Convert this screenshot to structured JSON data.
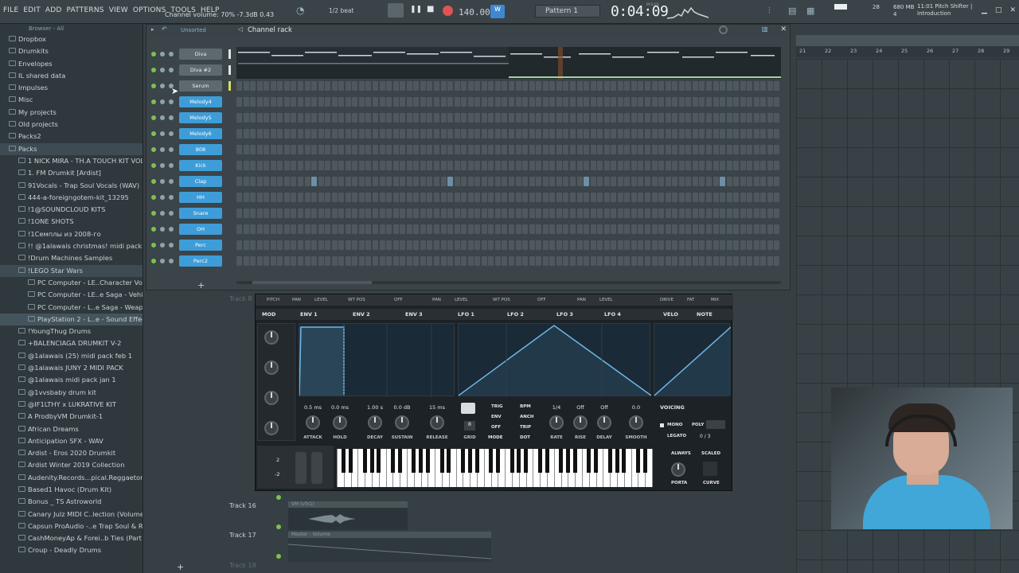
{
  "menu": [
    "FILE",
    "EDIT",
    "ADD",
    "PATTERNS",
    "VIEW",
    "OPTIONS",
    "TOOLS",
    "HELP"
  ],
  "hint_text": "Channel volume: 70%  -7.3dB  0.43",
  "beat_snap": "1/2 beat",
  "tempo": "140.000",
  "pattern": "Pattern 1",
  "song_time": "0:04:09",
  "time_unit": "M:S:CS",
  "cpu_value": "28",
  "mem": "680 MB",
  "voices": "4",
  "hint_right_time": "11:01",
  "hint_right_title": "Pitch Shifter |",
  "hint_right_sub": "Introduction",
  "browser": {
    "header": "Browser - All",
    "items": [
      {
        "label": "Dropbox",
        "indent": 0
      },
      {
        "label": "Drumkits",
        "indent": 0
      },
      {
        "label": "Envelopes",
        "indent": 0
      },
      {
        "label": "IL shared data",
        "indent": 0
      },
      {
        "label": "Impulses",
        "indent": 0
      },
      {
        "label": "Misc",
        "indent": 0
      },
      {
        "label": "My projects",
        "indent": 0
      },
      {
        "label": "Old projects",
        "indent": 0
      },
      {
        "label": "Packs2",
        "indent": 0
      },
      {
        "label": "Packs",
        "indent": 0,
        "sel": "sel2"
      },
      {
        "label": "1 NICK MIRA - TH.A TOUCH KIT VOL 1",
        "indent": 1
      },
      {
        "label": "1. FM Drumkit [Ardist]",
        "indent": 1
      },
      {
        "label": "91Vocals - Trap Soul Vocals (WAV)",
        "indent": 1
      },
      {
        "label": "444-a-foreigngotem-kit_13295",
        "indent": 1
      },
      {
        "label": "!1@SOUNDCLOUD KITS",
        "indent": 1
      },
      {
        "label": "!1ONE SHOTS",
        "indent": 1
      },
      {
        "label": "!1Семплы из 2008-го",
        "indent": 1
      },
      {
        "label": "!! @1alawais christmas! midi pack",
        "indent": 1
      },
      {
        "label": "!Drum Machines Samples",
        "indent": 1
      },
      {
        "label": "!LEGO Star Wars",
        "indent": 1,
        "sel": "sel2"
      },
      {
        "label": "PC Computer - LE..Character Voices",
        "indent": 2
      },
      {
        "label": "PC Computer - LE..e Saga - Vehicles",
        "indent": 2
      },
      {
        "label": "PC Computer - L..e Saga - Weapons",
        "indent": 2
      },
      {
        "label": "PlayStation 2 - L..e - Sound Effects",
        "indent": 2,
        "sel": "sel"
      },
      {
        "label": "!YoungThug Drums",
        "indent": 1
      },
      {
        "label": "+BALENCIAGA DRUMKIT V-2",
        "indent": 1
      },
      {
        "label": "@1alawais (25) midi pack feb 1",
        "indent": 1
      },
      {
        "label": "@1alawais JUNY 2 MIDI PACK",
        "indent": 1
      },
      {
        "label": "@1alawais midi pack jan 1",
        "indent": 1
      },
      {
        "label": "@1vvsbaby drum kit",
        "indent": 1
      },
      {
        "label": "@IF1LTHY x LUKRATIVE KIT",
        "indent": 1
      },
      {
        "label": "A ProdbyVM Drumkit-1",
        "indent": 1
      },
      {
        "label": "African Dreams",
        "indent": 1
      },
      {
        "label": "Anticipation SFX - WAV",
        "indent": 1
      },
      {
        "label": "Ardist - Eros 2020 Drumkit",
        "indent": 1
      },
      {
        "label": "Ardist Winter 2019 Collection",
        "indent": 1
      },
      {
        "label": "Audenity.Records...pical.Reggaeton.2",
        "indent": 1
      },
      {
        "label": "Based1 Havoc (Drum Kit)",
        "indent": 1
      },
      {
        "label": "Bonus _ TS Astroworld",
        "indent": 1
      },
      {
        "label": "Canary Julz MIDI C..lection (Volume 1)",
        "indent": 1
      },
      {
        "label": "Capsun ProAudio -..e Trap Soul & RnB",
        "indent": 1
      },
      {
        "label": "CashMoneyAp & Forei..b Ties (Part II )",
        "indent": 1
      },
      {
        "label": "Croup - Deadly Drums",
        "indent": 1
      }
    ]
  },
  "rack": {
    "filter": "Unsorted",
    "title": "Channel rack",
    "channels": [
      {
        "name": "Diva",
        "style": "gray"
      },
      {
        "name": "Diva #2",
        "style": "gray"
      },
      {
        "name": "Serum",
        "style": "gray"
      },
      {
        "name": "Melody4",
        "style": "blue"
      },
      {
        "name": "Melody5",
        "style": "blue"
      },
      {
        "name": "Melody6",
        "style": "blue"
      },
      {
        "name": "808",
        "style": "blue"
      },
      {
        "name": "Kick",
        "style": "blue"
      },
      {
        "name": "Clap",
        "style": "blue"
      },
      {
        "name": "HH",
        "style": "blue"
      },
      {
        "name": "Snare",
        "style": "blue"
      },
      {
        "name": "OH",
        "style": "blue"
      },
      {
        "name": "Perc",
        "style": "blue"
      },
      {
        "name": "Perc2",
        "style": "blue"
      }
    ]
  },
  "playlist": {
    "ruler": [
      "21",
      "22",
      "23",
      "24",
      "25",
      "26",
      "27",
      "28",
      "29"
    ],
    "tracks": [
      {
        "label": "Track 8",
        "dim": true
      },
      {
        "label": "Track 16",
        "dim": false
      },
      {
        "label": "Track 17",
        "dim": false
      },
      {
        "label": "Track 18",
        "dim": true
      }
    ],
    "clips": [
      "VM (vfx1)",
      "Master - Volume"
    ]
  },
  "serum": {
    "top_tabs": [
      "PITCH",
      "PAN",
      "LEVEL",
      "WT POS",
      "OFF",
      "PAN",
      "LEVEL",
      "WT POS",
      "OFF",
      "PAN",
      "LEVEL",
      "DRIVE",
      "FAT",
      "MIX"
    ],
    "mod_tabs": [
      "MOD",
      "ENV 1",
      "ENV 2",
      "ENV 3",
      "LFO 1",
      "LFO 2",
      "LFO 3",
      "LFO 4",
      "VELO",
      "NOTE"
    ],
    "env_values": [
      "0.5 ms",
      "0.0 ms",
      "1.00 s",
      "0.0 dB",
      "15 ms"
    ],
    "env_labels": [
      "ATTACK",
      "HOLD",
      "DECAY",
      "SUSTAIN",
      "RELEASE"
    ],
    "lfo_values": [
      "1/4",
      "Off",
      "Off",
      "0.0"
    ],
    "lfo_labels": [
      "RATE",
      "RISE",
      "DELAY",
      "SMOOTH"
    ],
    "lfo_opts": [
      "TRIG",
      "ENV",
      "OFF",
      "BPM",
      "ANCH",
      "TRIP",
      "GRID",
      "MODE",
      "DOT"
    ],
    "grid_val": "8",
    "voicing": "VOICING",
    "mono": "MONO",
    "poly": "POLY",
    "legato": "LEGATO",
    "legato_val": "0 / 3",
    "always": "ALWAYS",
    "scaled": "SCALED",
    "porta": "PORTA",
    "curve": "CURVE",
    "pitch_up": "2",
    "pitch_down": "-2"
  }
}
